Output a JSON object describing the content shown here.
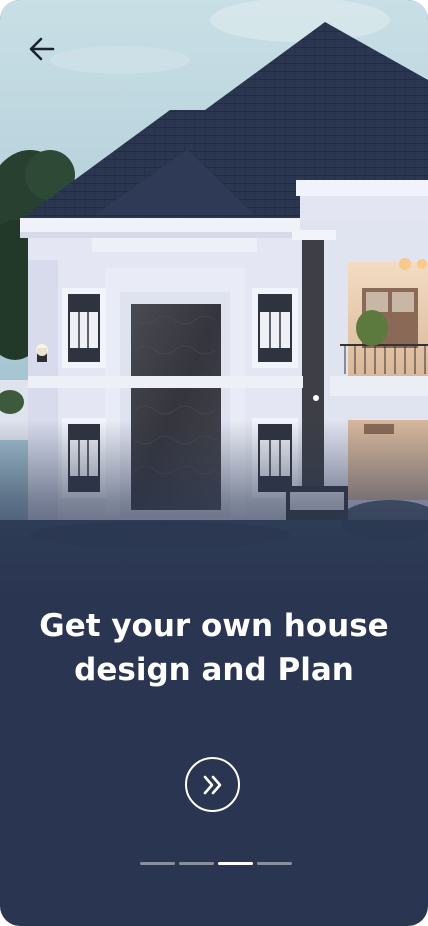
{
  "onboarding": {
    "headline_line1": "Get your own house",
    "headline_line2": "design and Plan",
    "current_page": 3,
    "total_pages": 4
  },
  "colors": {
    "background": "#2a3651",
    "roof": "#2b3650",
    "wall": "#e6e9f5",
    "text": "#ffffff",
    "indicator_inactive": "#8a8f9c",
    "indicator_active": "#ffffff"
  },
  "icons": {
    "back": "arrow-left-icon",
    "next": "double-chevron-right-icon"
  }
}
